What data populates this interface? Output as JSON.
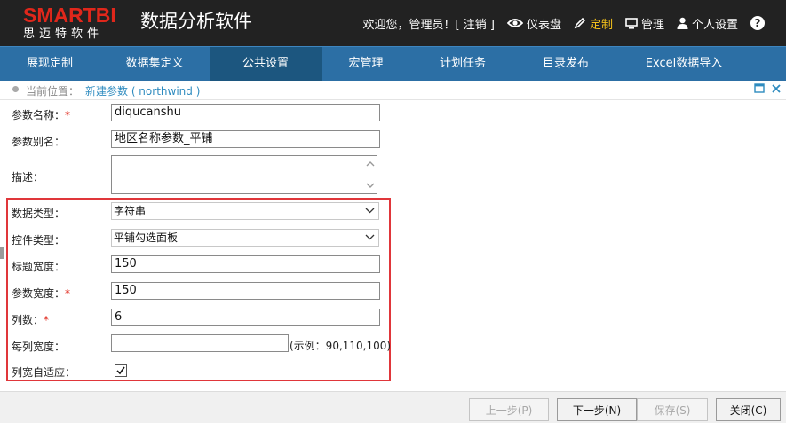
{
  "header": {
    "logo_text": "SMARTBI",
    "logo_sub": "思迈特软件",
    "app_title": "数据分析软件",
    "welcome": "欢迎您，管理员！[ 注销 ]",
    "dashboard": "仪表盘",
    "customize": "定制",
    "manage": "管理",
    "personal": "个人设置",
    "help": "?"
  },
  "nav": {
    "items": [
      "展现定制",
      "数据集定义",
      "公共设置",
      "宏管理",
      "计划任务",
      "目录发布",
      "Excel数据导入"
    ]
  },
  "breadcrumb": {
    "label": "当前位置：",
    "path": "新建参数 ( northwind )"
  },
  "form": {
    "param_name_label": "参数名称：",
    "param_name_value": "diqucanshu",
    "param_alias_label": "参数别名：",
    "param_alias_value": "地区名称参数_平铺",
    "desc_label": "描述：",
    "data_type_label": "数据类型：",
    "data_type_value": "字符串",
    "control_type_label": "控件类型：",
    "control_type_value": "平铺勾选面板",
    "title_width_label": "标题宽度：",
    "title_width_value": "150",
    "param_width_label": "参数宽度：",
    "param_width_value": "150",
    "columns_label": "列数：",
    "columns_value": "6",
    "col_width_label": "每列宽度：",
    "col_width_value": "",
    "col_width_hint": "(示例：90,110,100)",
    "auto_fit_label": "列宽自适应：",
    "required_mark": "*"
  },
  "footer": {
    "prev": "上一步(P)",
    "next": "下一步(N)",
    "save": "保存(S)",
    "close": "关闭(C)"
  },
  "colors": {
    "header_bg": "#222222",
    "nav_bg": "#2c6fa5",
    "nav_active": "#1c567f",
    "accent_red": "#e0271b",
    "link": "#2e8bbf"
  }
}
